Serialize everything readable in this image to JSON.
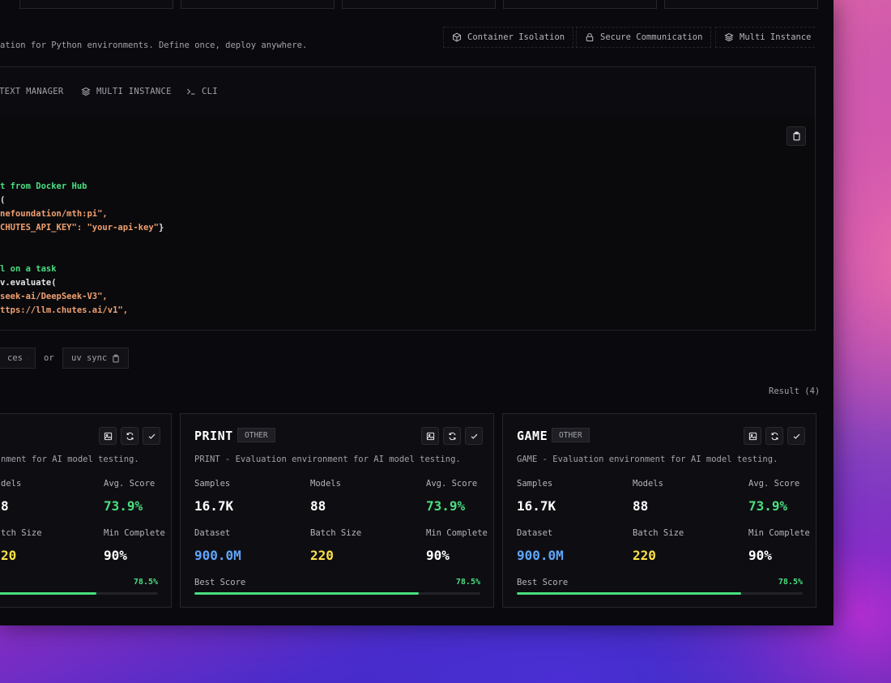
{
  "subtitle": "ation for Python environments. Define once, deploy anywhere.",
  "features": [
    {
      "label": "Container Isolation",
      "icon": "cube-icon"
    },
    {
      "label": "Secure Communication",
      "icon": "lock-icon"
    },
    {
      "label": "Multi Instance",
      "icon": "layers-icon"
    }
  ],
  "tabs": [
    {
      "label": "TEXT MANAGER",
      "icon": ""
    },
    {
      "label": "MULTI INSTANCE",
      "icon": "layers-icon"
    },
    {
      "label": "CLI",
      "icon": "terminal-icon"
    }
  ],
  "code": {
    "line1": "t from Docker Hub",
    "line2": "(",
    "line3": "nefoundation/mth:pi\",",
    "line4a": "CHUTES_API_KEY\": ",
    "line4b": "\"your-api-key\"",
    "line4c": "}",
    "line5": "l on a task",
    "line6": "v.evaluate(",
    "line7": "seek-ai/DeepSeek-V3\",",
    "line8": "ttps://llm.chutes.ai/v1\","
  },
  "install": {
    "cmd1": "ces",
    "or_label": "or",
    "cmd2": "uv sync"
  },
  "result_label": "Result (4)",
  "colors": {
    "accent_green": "#4ade80",
    "accent_blue": "#60a5fa",
    "accent_yellow": "#fde047"
  },
  "cards": [
    {
      "title": "",
      "badge": "",
      "desc": "nment for AI model testing.",
      "labels": {
        "samples": "",
        "models": "dels",
        "avg": "Avg. Score",
        "dataset": "",
        "batch": "tch Size",
        "min": "Min Complete"
      },
      "values": {
        "samples": "",
        "models": "8",
        "avg": "73.9%",
        "dataset": "",
        "batch": "20",
        "min": "90%"
      },
      "best_label": "",
      "best_value": "78.5%",
      "best_fraction": 0.785
    },
    {
      "title": "PRINT",
      "badge": "OTHER",
      "desc": "PRINT - Evaluation environment for AI model testing.",
      "labels": {
        "samples": "Samples",
        "models": "Models",
        "avg": "Avg. Score",
        "dataset": "Dataset",
        "batch": "Batch Size",
        "min": "Min Complete"
      },
      "values": {
        "samples": "16.7K",
        "models": "88",
        "avg": "73.9%",
        "dataset": "900.0M",
        "batch": "220",
        "min": "90%"
      },
      "best_label": "Best Score",
      "best_value": "78.5%",
      "best_fraction": 0.785
    },
    {
      "title": "GAME",
      "badge": "OTHER",
      "desc": "GAME - Evaluation environment for AI model testing.",
      "labels": {
        "samples": "Samples",
        "models": "Models",
        "avg": "Avg. Score",
        "dataset": "Dataset",
        "batch": "Batch Size",
        "min": "Min Complete"
      },
      "values": {
        "samples": "16.7K",
        "models": "88",
        "avg": "73.9%",
        "dataset": "900.0M",
        "batch": "220",
        "min": "90%"
      },
      "best_label": "Best Score",
      "best_value": "78.5%",
      "best_fraction": 0.785
    }
  ]
}
